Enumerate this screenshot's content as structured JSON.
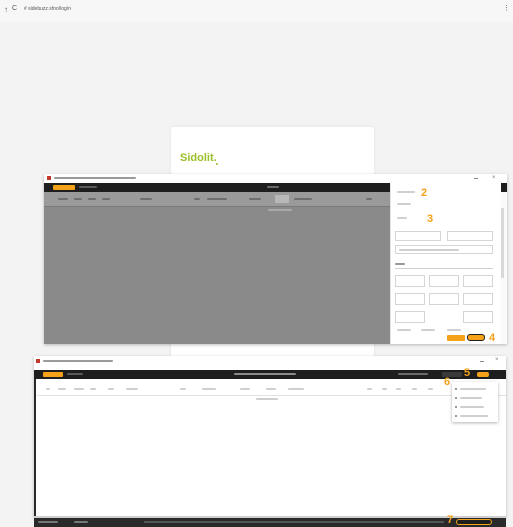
{
  "browser": {
    "nav_glyph": "↑",
    "refresh_glyph": "C",
    "address": "# sidebuzz.sfoo/log/n",
    "menu_glyph": "⋮"
  },
  "card": {
    "logo": "Sidolit."
  },
  "top_window": {
    "tag_2": "2",
    "tag_3": "3",
    "tag_4": "4"
  },
  "bottom_window": {
    "tag_5": "5",
    "tag_6": "6",
    "tag_7": "7"
  },
  "colors": {
    "page_bg": "#f3f3f3",
    "app_dark": "#1e1e1e",
    "accent_orange": "#f5a11a",
    "grid_gray": "#8a8a8a"
  },
  "icons": {
    "close": "close-icon",
    "minimize": "minimize-icon",
    "menu": "kebab-icon"
  }
}
